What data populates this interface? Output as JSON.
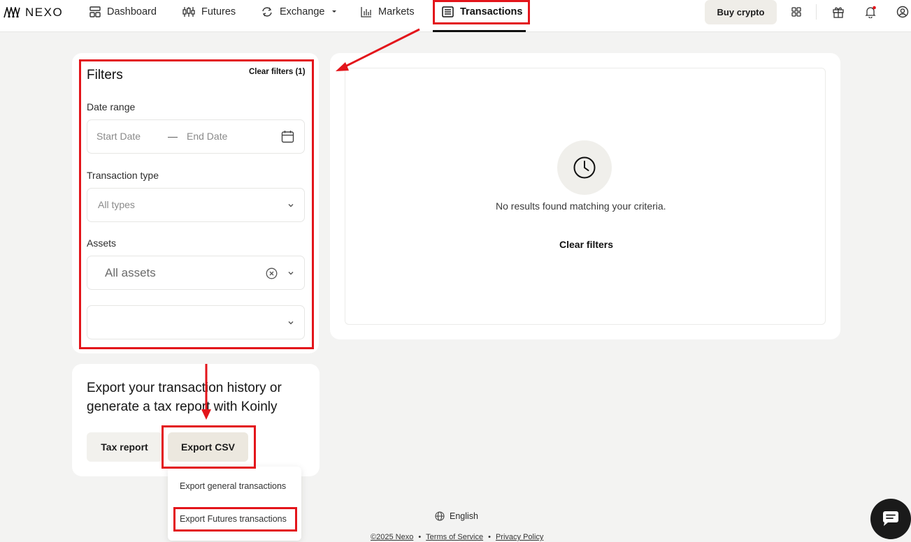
{
  "nav": {
    "logo_text": "NEXO",
    "items": [
      {
        "label": "Dashboard",
        "icon": "dashboard-icon"
      },
      {
        "label": "Futures",
        "icon": "candlestick-icon"
      },
      {
        "label": "Exchange",
        "icon": "exchange-icon"
      },
      {
        "label": "Markets",
        "icon": "bar-chart-icon"
      },
      {
        "label": "Transactions",
        "icon": "list-icon",
        "active": true
      }
    ],
    "buy_crypto": "Buy crypto",
    "icons": [
      "apps-grid-icon",
      "gift-icon",
      "bell-icon",
      "user-icon"
    ]
  },
  "filters": {
    "title": "Filters",
    "clear_filters_label": "Clear filters (1)",
    "date_range": {
      "label": "Date range",
      "start_placeholder": "Start Date",
      "separator": "—",
      "end_placeholder": "End Date"
    },
    "transaction_type": {
      "label": "Transaction type",
      "value": "All types"
    },
    "assets": {
      "label": "Assets",
      "value": "All assets"
    },
    "extra_select": {
      "value": ""
    }
  },
  "results": {
    "empty_message": "No results found matching your criteria.",
    "clear_filters_button": "Clear filters"
  },
  "export": {
    "title": "Export your transaction history or generate a tax report with Koinly",
    "tax_report_button": "Tax report",
    "export_csv_button": "Export CSV",
    "menu": [
      "Export general transactions",
      "Export Futures transactions"
    ]
  },
  "footer": {
    "language": "English",
    "copyright": "©2025 Nexo",
    "bullet": "•",
    "terms": "Terms of Service",
    "privacy": "Privacy Policy"
  },
  "colors": {
    "highlight": "#e3151b",
    "accent_bg": "#efede8"
  }
}
